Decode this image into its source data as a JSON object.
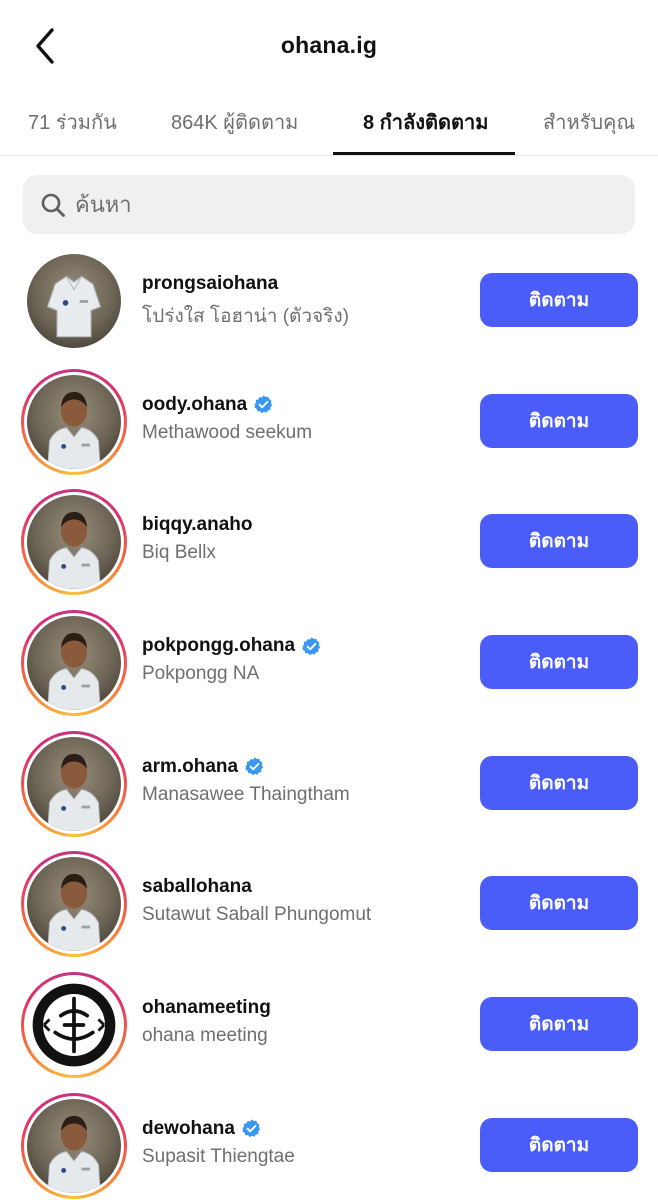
{
  "header": {
    "title": "ohana.ig",
    "back_icon": "chevron-left-icon"
  },
  "tabs": [
    {
      "label": "71 ร่วมกัน",
      "active": false
    },
    {
      "label": "864K ผู้ติดตาม",
      "active": false
    },
    {
      "label": "8 กำลังติดตาม",
      "active": true
    },
    {
      "label": "สำหรับคุณ",
      "active": false
    }
  ],
  "search": {
    "placeholder": "ค้นหา",
    "icon": "search-icon"
  },
  "colors": {
    "accent": "#4a5df9",
    "verified": "#3897f0",
    "secondary_text": "#6f6f6f"
  },
  "users": [
    {
      "username": "prongsaiohana",
      "full_name": "โปร่งใส โอฮาน่า (ตัวจริง)",
      "verified": false,
      "story_ring": false,
      "avatar": "shirt",
      "button": "ติดตาม"
    },
    {
      "username": "oody.ohana",
      "full_name": "Methawood seekum",
      "verified": true,
      "story_ring": true,
      "avatar": "person",
      "button": "ติดตาม"
    },
    {
      "username": "biqqy.anaho",
      "full_name": "Biq Bellx",
      "verified": false,
      "story_ring": true,
      "avatar": "person",
      "button": "ติดตาม"
    },
    {
      "username": "pokpongg.ohana",
      "full_name": "Pokpongg NA",
      "verified": true,
      "story_ring": true,
      "avatar": "person",
      "button": "ติดตาม"
    },
    {
      "username": "arm.ohana",
      "full_name": "Manasawee Thaingtham",
      "verified": true,
      "story_ring": true,
      "avatar": "person",
      "button": "ติดตาม"
    },
    {
      "username": "saballohana",
      "full_name": "Sutawut Saball Phungomut",
      "verified": false,
      "story_ring": true,
      "avatar": "person",
      "button": "ติดตาม"
    },
    {
      "username": "ohanameeting",
      "full_name": "ohana meeting",
      "verified": false,
      "story_ring": true,
      "avatar": "logo",
      "button": "ติดตาม"
    },
    {
      "username": "dewohana",
      "full_name": "Supasit Thiengtae",
      "verified": true,
      "story_ring": true,
      "avatar": "person",
      "button": "ติดตาม"
    }
  ]
}
